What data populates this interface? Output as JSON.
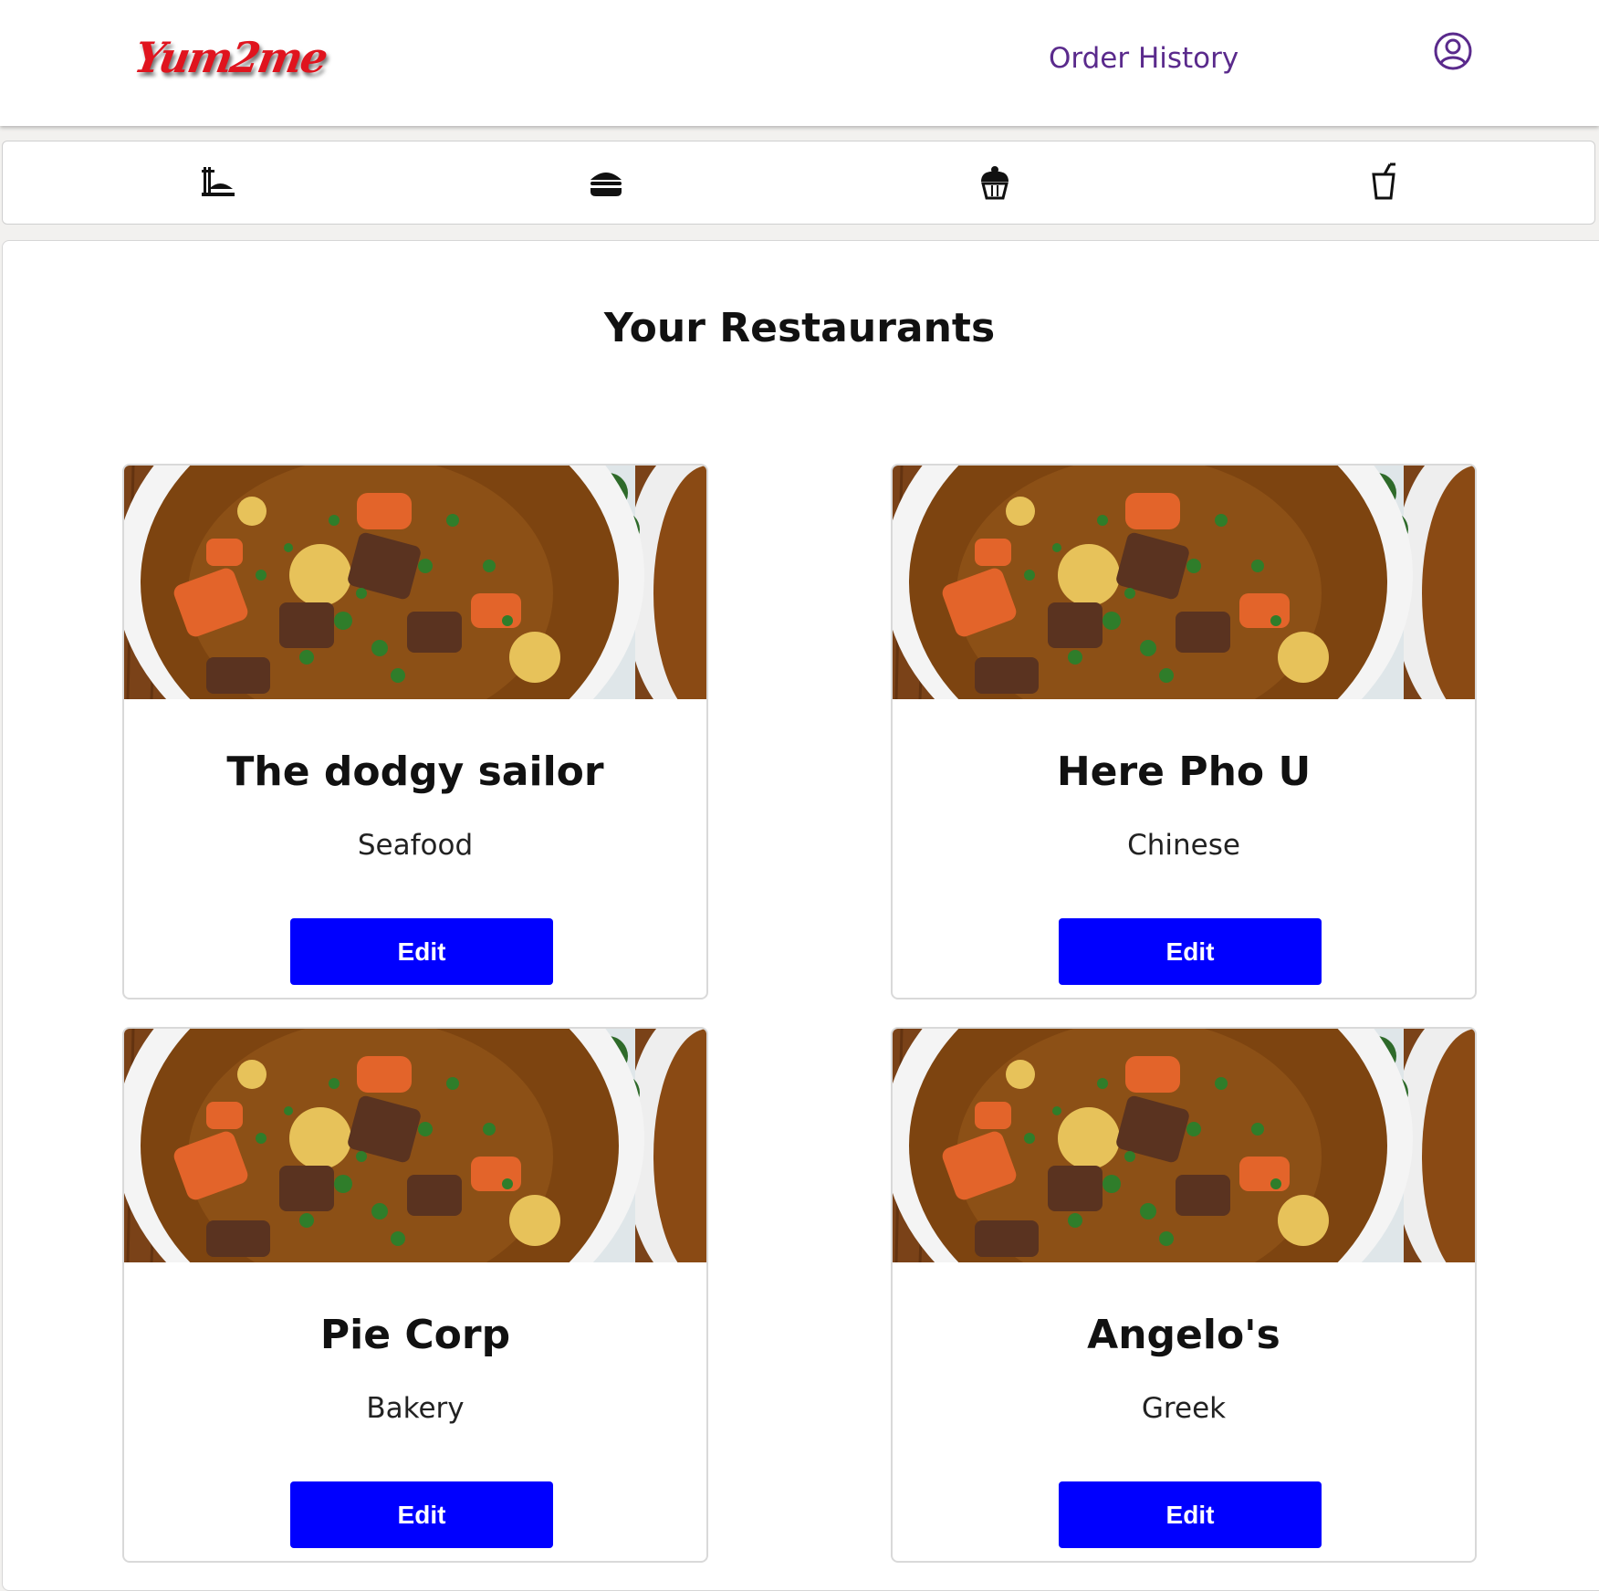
{
  "header": {
    "logo_text": "Yum2me",
    "order_history_label": "Order History",
    "profile_icon": "user-circle-icon",
    "logo_color": "#e0141e",
    "link_color": "#5a2a8c"
  },
  "categories": [
    {
      "icon": "noodles-icon"
    },
    {
      "icon": "burger-icon"
    },
    {
      "icon": "cupcake-icon"
    },
    {
      "icon": "drink-icon"
    }
  ],
  "main": {
    "title": "Your Restaurants",
    "restaurants": [
      {
        "name": "The dodgy sailor",
        "cuisine": "Seafood",
        "edit_label": "Edit",
        "image": "stew-photo"
      },
      {
        "name": "Here Pho U",
        "cuisine": "Chinese",
        "edit_label": "Edit",
        "image": "stew-photo"
      },
      {
        "name": "Pie Corp",
        "cuisine": "Bakery",
        "edit_label": "Edit",
        "image": "stew-photo"
      },
      {
        "name": "Angelo's",
        "cuisine": "Greek",
        "edit_label": "Edit",
        "image": "stew-photo"
      }
    ],
    "button_color": "#0000ff"
  }
}
